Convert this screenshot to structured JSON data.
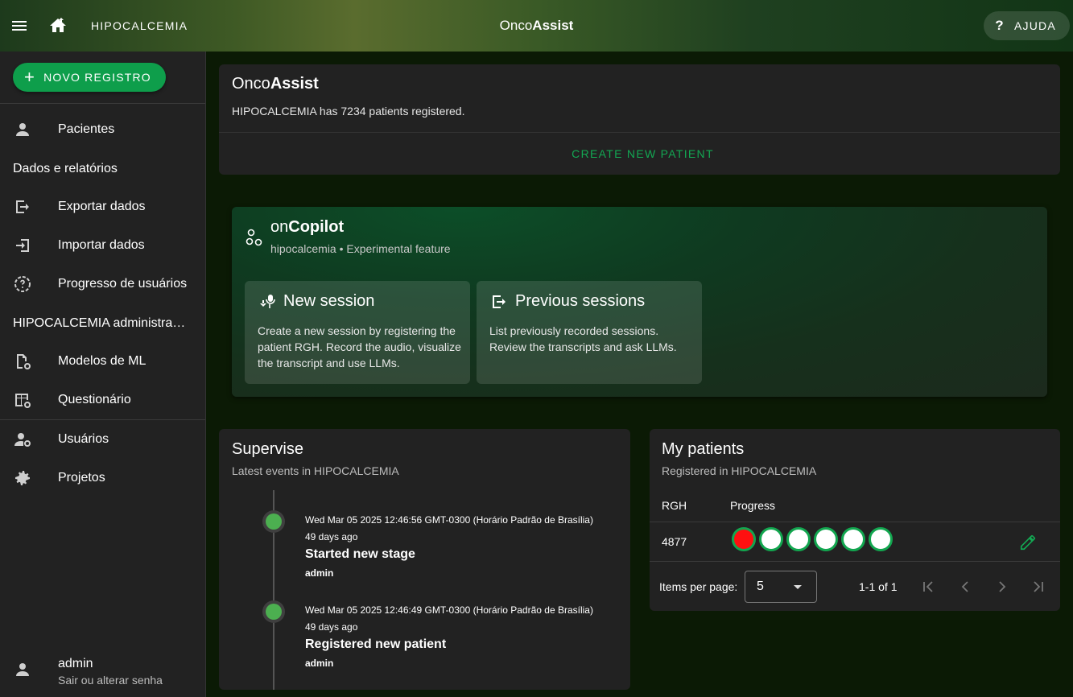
{
  "header": {
    "project_name": "HIPOCALCEMIA",
    "brand_light": "Onco",
    "brand_bold": "Assist",
    "help_label": "AJUDA"
  },
  "sidebar": {
    "new_button_label": "NOVO REGISTRO",
    "items": [
      {
        "label": "Pacientes",
        "icon": "person-icon"
      },
      {
        "label": "Exportar dados",
        "icon": "export-icon"
      },
      {
        "label": "Importar dados",
        "icon": "import-icon"
      },
      {
        "label": "Progresso de usuários",
        "icon": "progress-icon"
      },
      {
        "label": "Modelos de ML",
        "icon": "ml-models-icon"
      },
      {
        "label": "Questionário",
        "icon": "questionnaire-icon"
      },
      {
        "label": "Usuários",
        "icon": "users-settings-icon"
      },
      {
        "label": "Projetos",
        "icon": "gear-icon"
      }
    ],
    "section_data": "Dados e relatórios",
    "section_admin": "HIPOCALCEMIA administra…",
    "user": {
      "name": "admin",
      "subtitle": "Sair ou alterar senha"
    }
  },
  "summary": {
    "title_light": "Onco",
    "title_bold": "Assist",
    "description": "HIPOCALCEMIA has 7234 patients registered.",
    "create_label": "CREATE NEW PATIENT"
  },
  "copilot": {
    "title_light": "on",
    "title_bold": "Copilot",
    "subtitle": "hipocalcemia • Experimental feature",
    "tiles": [
      {
        "title": "New session",
        "description": "Create a new session by registering the patient RGH. Record the audio, visualize the transcript and use LLMs."
      },
      {
        "title": "Previous sessions",
        "description": "List previously recorded sessions. Review the transcripts and ask LLMs."
      }
    ]
  },
  "supervise": {
    "title": "Supervise",
    "subtitle": "Latest events in HIPOCALCEMIA",
    "events": [
      {
        "date": "Wed Mar 05 2025 12:46:56 GMT-0300 (Horário Padrão de Brasília)",
        "ago": "49 days ago",
        "event": "Started new stage",
        "user": "admin"
      },
      {
        "date": "Wed Mar 05 2025 12:46:49 GMT-0300 (Horário Padrão de Brasília)",
        "ago": "49 days ago",
        "event": "Registered new patient",
        "user": "admin"
      }
    ]
  },
  "my_patients": {
    "title": "My patients",
    "subtitle": "Registered in HIPOCALCEMIA",
    "col_rgh": "RGH",
    "col_progress": "Progress",
    "rows": [
      {
        "rgh": "4877",
        "progress_stages": [
          "red",
          "white",
          "white",
          "white",
          "white",
          "white"
        ]
      }
    ],
    "items_per_page_label": "Items per page:",
    "items_per_page_value": "5",
    "range": "1-1 of 1"
  },
  "colors": {
    "accent_green": "#0e9e4b",
    "link_green": "#13a853",
    "card_bg": "#222222",
    "stage_done": "#ff1010"
  }
}
